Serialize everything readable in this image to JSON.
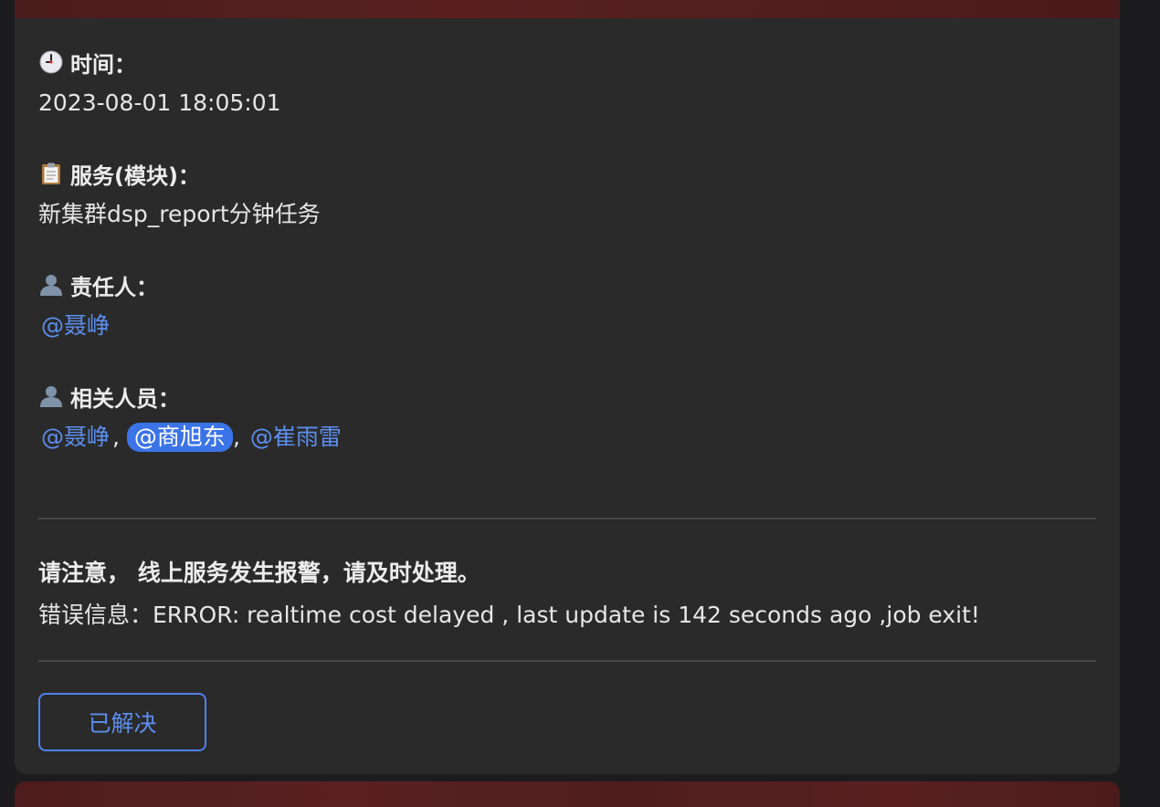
{
  "alert": {
    "time": {
      "icon": "clock-icon",
      "label": "时间：",
      "value": "2023-08-01 18:05:01"
    },
    "service": {
      "icon": "clipboard-icon",
      "label": "服务(模块)：",
      "value": "新集群dsp_report分钟任务"
    },
    "owner": {
      "icon": "person-icon",
      "label": "责任人：",
      "mentions": [
        "@聂峥"
      ]
    },
    "related": {
      "icon": "person-icon",
      "label": "相关人员：",
      "mentions": [
        "@聂峥",
        "@商旭东",
        "@崔雨雷"
      ],
      "separator": ","
    },
    "notice_title": "请注意， 线上服务发生报警，请及时处理。",
    "error_message": "错误信息：ERROR: realtime cost delayed , last update is 142 seconds ago ,job exit!"
  },
  "actions": {
    "resolve_label": "已解决"
  },
  "colors": {
    "card_background": "#2a2a2a",
    "header_red": "#5a2020",
    "mention_link": "#5b8ff0",
    "mention_highlight": "#3b74e8",
    "button_border": "#4f82ee"
  }
}
